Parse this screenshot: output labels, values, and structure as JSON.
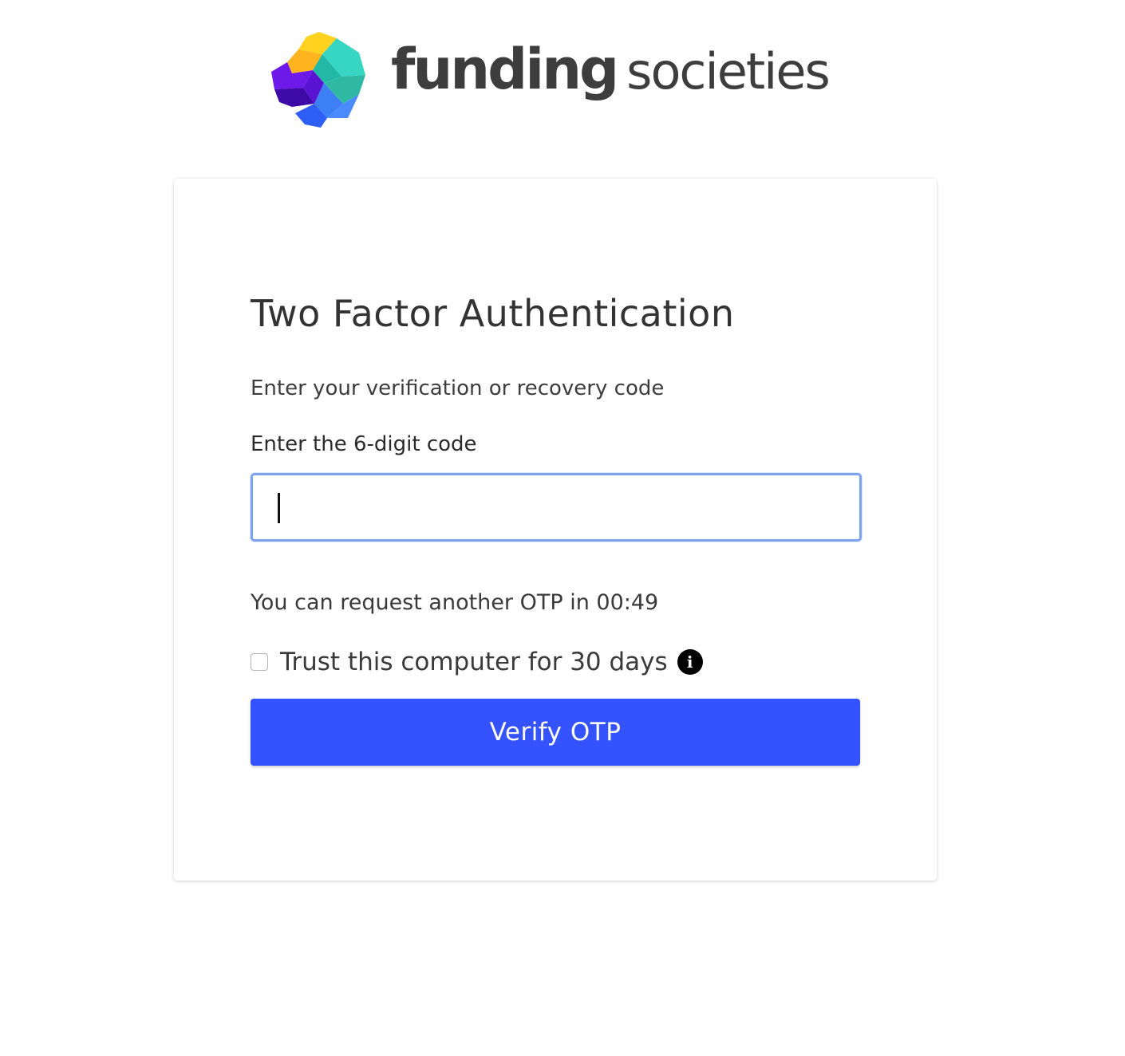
{
  "brand": {
    "name_part_1": "funding",
    "name_part_2": "societies",
    "logo_icon": "funding-societies-logo-icon"
  },
  "card": {
    "title": "Two Factor Authentication",
    "subtitle": "Enter your verification or recovery code",
    "code_label": "Enter the 6-digit code",
    "code_value": "",
    "timer_text": "You can request another OTP in 00:49",
    "trust_label": "Trust this computer for 30 days",
    "trust_checked": false,
    "info_icon": "info-icon",
    "verify_label": "Verify OTP"
  },
  "colors": {
    "primary": "#3453ff",
    "input_focus": "#7ea2ee",
    "text": "#333333"
  }
}
